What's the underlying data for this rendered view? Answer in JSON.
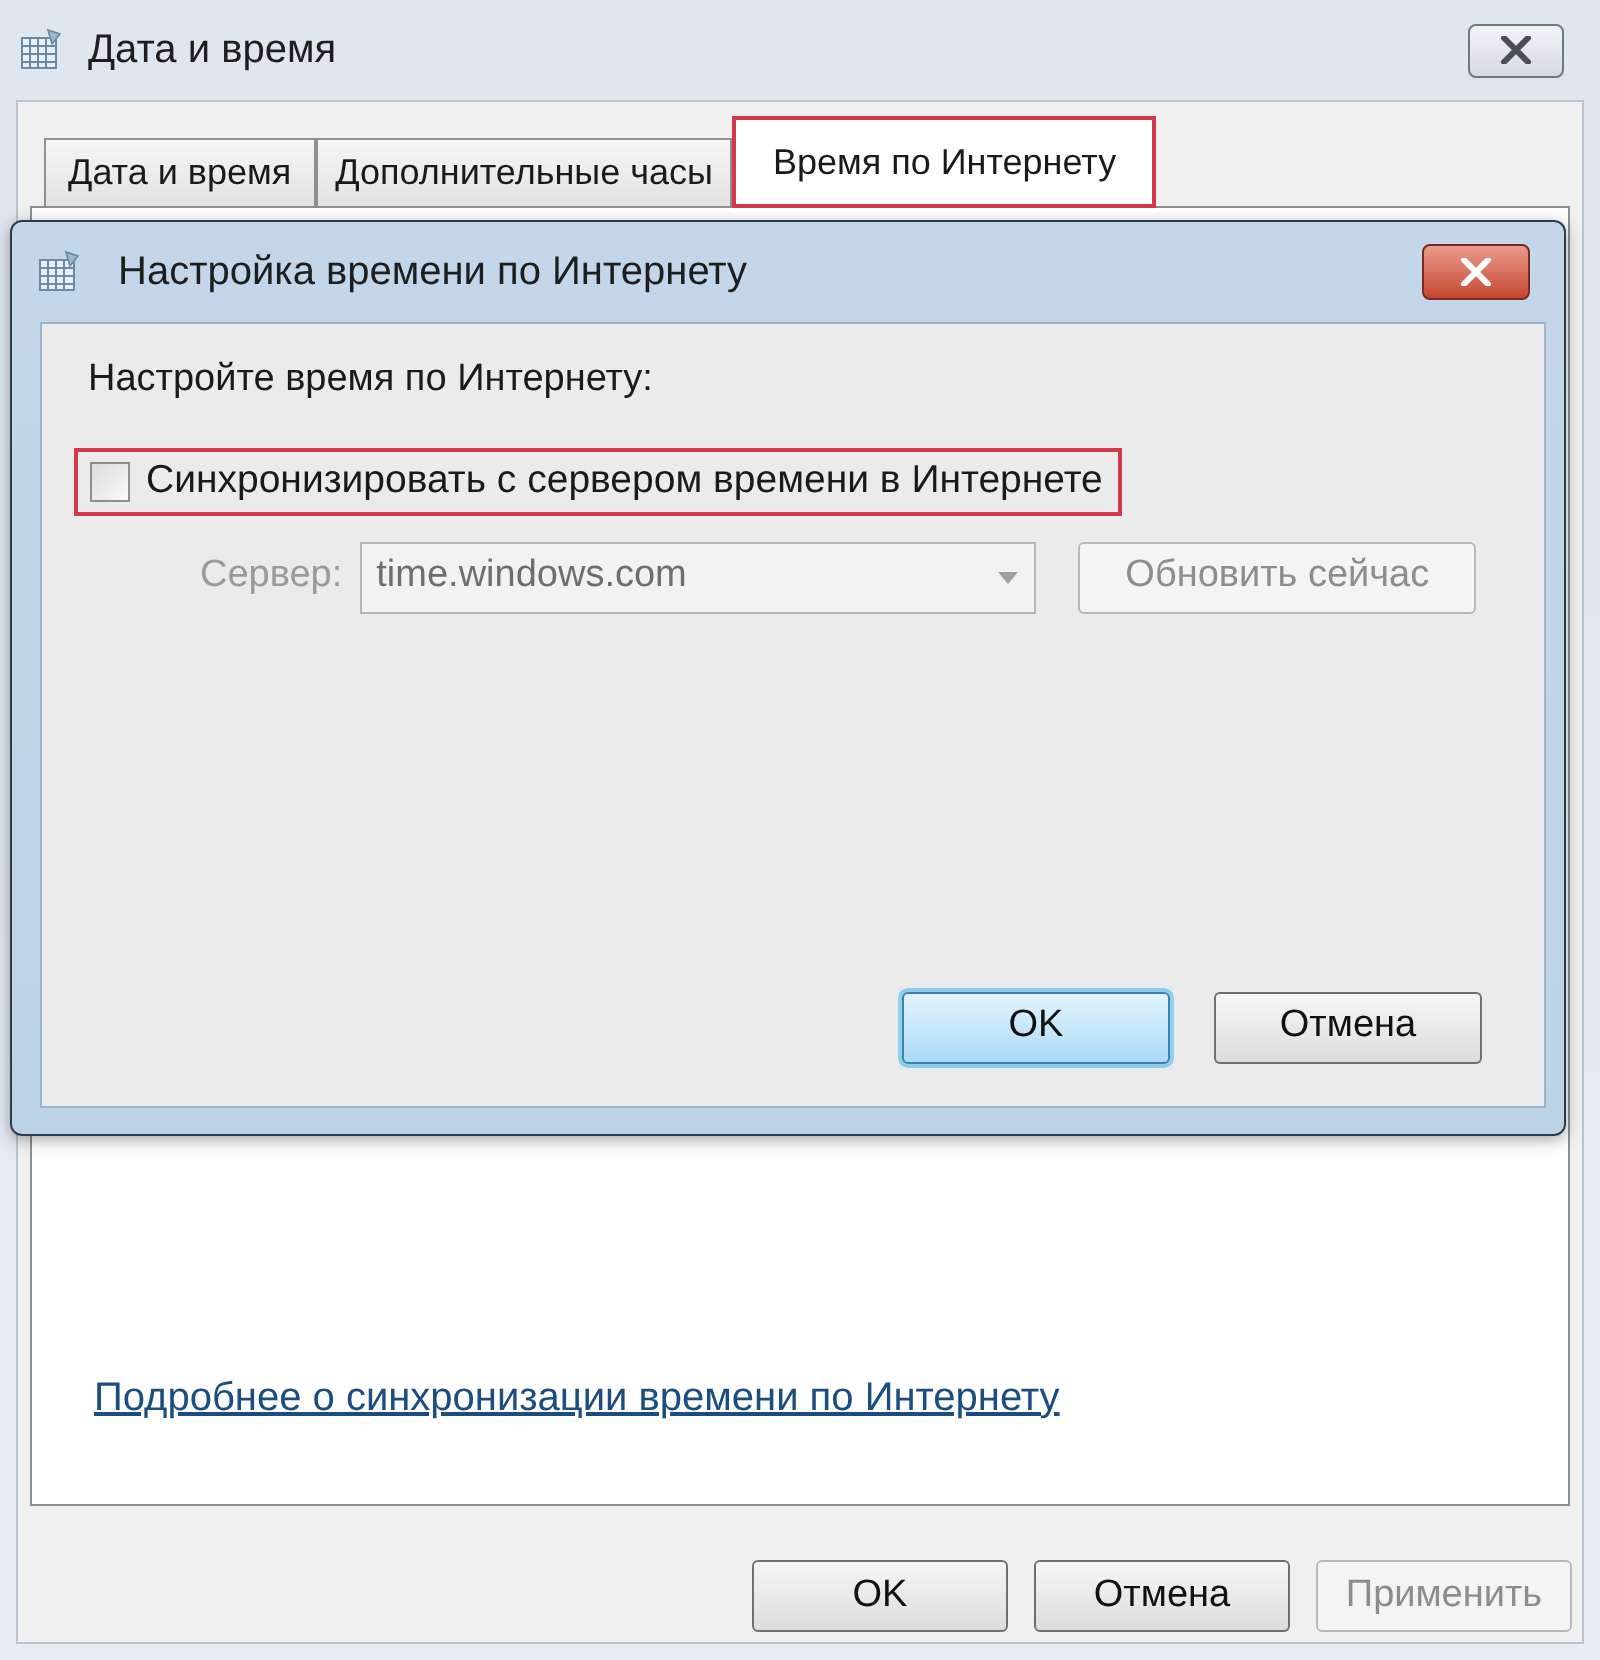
{
  "window": {
    "title": "Дата и время"
  },
  "tabs": [
    {
      "label": "Дата и время",
      "selected": false,
      "highlighted": false
    },
    {
      "label": "Дополнительные часы",
      "selected": false,
      "highlighted": false
    },
    {
      "label": "Время по Интернету",
      "selected": true,
      "highlighted": true
    }
  ],
  "panel": {
    "link": "Подробнее о синхронизации времени по Интернету"
  },
  "buttons": [
    {
      "label": "OK",
      "disabled": false
    },
    {
      "label": "Отмена",
      "disabled": false
    },
    {
      "label": "Применить",
      "disabled": true
    }
  ],
  "dialog": {
    "title": "Настройка времени по Интернету",
    "heading": "Настройте время по Интернету:",
    "sync_checkbox": {
      "label": "Синхронизировать с сервером времени в Интернете",
      "checked": false,
      "highlighted": true
    },
    "server": {
      "label": "Сервер:",
      "value": "time.windows.com",
      "disabled": true
    },
    "update_button": {
      "label": "Обновить сейчас",
      "disabled": true
    },
    "buttons": [
      {
        "label": "OK",
        "default": true
      },
      {
        "label": "Отмена",
        "default": false
      }
    ]
  }
}
